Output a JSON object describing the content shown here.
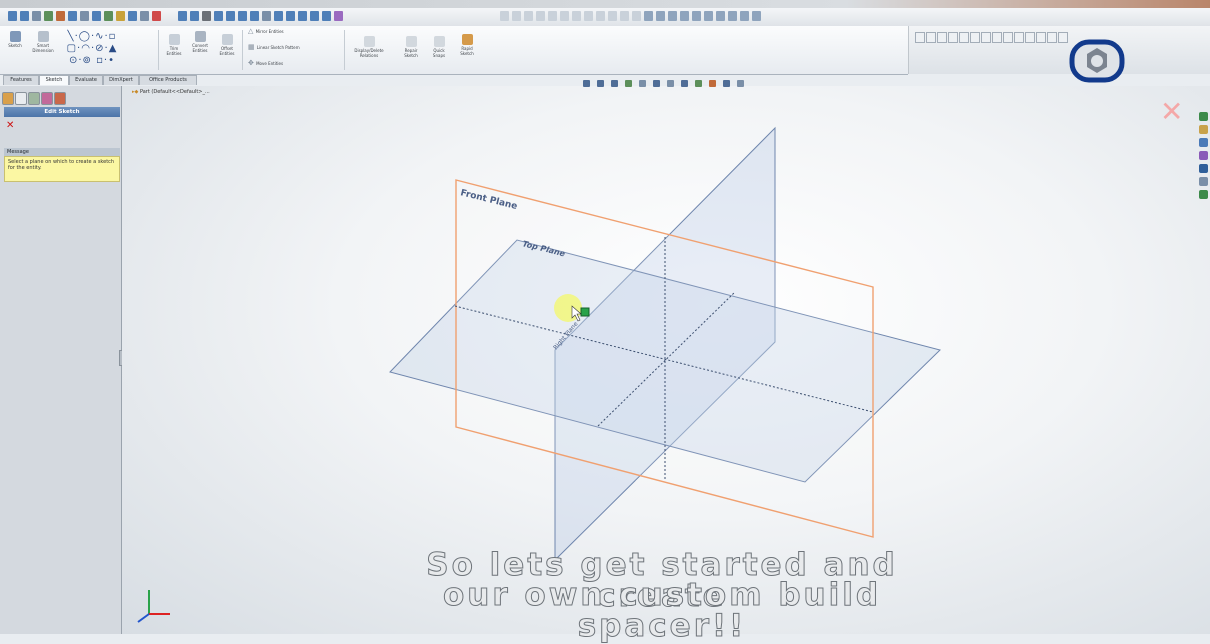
{
  "tabs": [
    "Features",
    "Sketch",
    "Evaluate",
    "DimXpert",
    "Office Products"
  ],
  "active_tab": "Sketch",
  "toolbar": {
    "sketch_label": "Sketch",
    "smart_dimension_label": "Smart Dimension",
    "trim_label": "Trim Entities",
    "convert_label": "Convert Entities",
    "offset_label": "Offset Entities",
    "mirror_label": "Mirror Entities",
    "linear_pattern_label": "Linear Sketch Pattern",
    "move_label": "Move Entities",
    "display_relations_label": "Display/Delete Relations",
    "repair_label": "Repair Sketch",
    "quick_snaps_label": "Quick Snaps",
    "rapid_sketch_label": "Rapid Sketch"
  },
  "property_manager": {
    "title": "Edit Sketch",
    "message_header": "Message",
    "message_text": "Select a plane on which to create a sketch for the entity."
  },
  "feature_tree": {
    "root_label": "Part (Default<<Default>_..."
  },
  "viewport": {
    "front_plane_label": "Front Plane",
    "top_plane_label": "Top Plane",
    "right_plane_label": "Right Plane"
  },
  "caption": {
    "line1": "So lets get started and create",
    "line2": "our own custom build spacer!!"
  },
  "colors": {
    "front_plane_edge": "#f0a070",
    "plane_edge": "#6f86ad",
    "annotation_circle": "#123a8c",
    "highlight": "#f4f86a"
  },
  "icons": {
    "close": "close-icon",
    "spacer_logo": "nut-icon",
    "triad": "axis-triad-icon"
  }
}
